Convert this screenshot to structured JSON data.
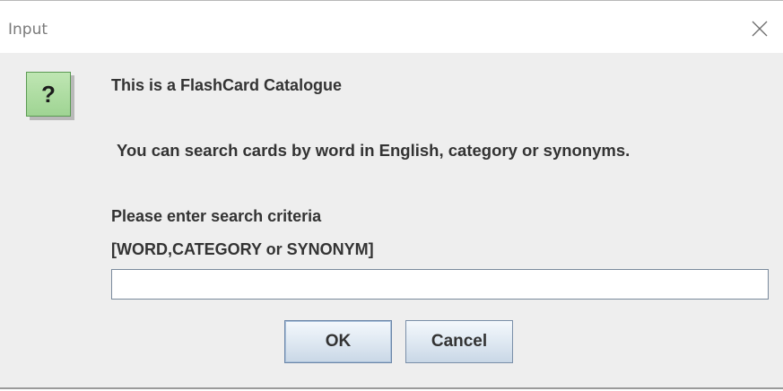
{
  "window": {
    "title": "Input"
  },
  "icon": {
    "name": "question-icon",
    "glyph": "?",
    "color": "#9fd493"
  },
  "message": {
    "title": "This is a FlashCard Catalogue",
    "description": "You can search cards by word in English, category or synonyms.",
    "prompt": "Please enter search criteria",
    "criteria": "[WORD,CATEGORY or SYNONYM]"
  },
  "input": {
    "value": "",
    "placeholder": ""
  },
  "buttons": {
    "ok_label": "OK",
    "cancel_label": "Cancel"
  }
}
